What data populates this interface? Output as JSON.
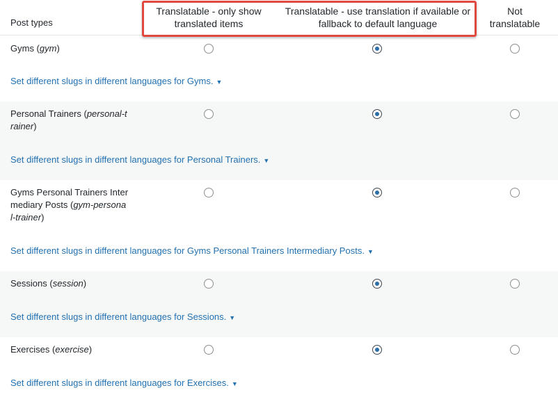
{
  "header": {
    "col_post_types": "Post types",
    "col_translatable_only": "Translatable - only show translated items",
    "col_translatable_fallback": "Translatable - use translation if available or fallback to default language",
    "col_not_translatable": "Not translatable"
  },
  "rows": [
    {
      "name_lines": [
        "Gyms (",
        "gym",
        ")"
      ],
      "selected": "fallback",
      "slug_link": "Set different slugs in different languages for Gyms."
    },
    {
      "name_line1_plain": "Personal Trainers (",
      "name_line1_italic": "personal-t",
      "name_line2_italic": "rainer",
      "name_line2_plain": ")",
      "selected": "fallback",
      "slug_link": "Set different slugs in different languages for Personal Trainers."
    },
    {
      "name_line1": "Gyms Personal Trainers Inter",
      "name_line2_plain": "mediary Posts (",
      "name_line2_italic": "gym-persona",
      "name_line3_italic": "l-trainer",
      "name_line3_plain": ")",
      "selected": "fallback",
      "slug_link": "Set different slugs in different languages for Gyms Personal Trainers Intermediary Posts."
    },
    {
      "name_plain": "Sessions (",
      "name_italic": "session",
      "name_close": ")",
      "selected": "fallback",
      "slug_link": "Set different slugs in different languages for Sessions."
    },
    {
      "name_plain": "Exercises (",
      "name_italic": "exercise",
      "name_close": ")",
      "selected": "fallback",
      "slug_link": "Set different slugs in different languages for Exercises."
    }
  ],
  "caret_glyph": "▼",
  "colors": {
    "link": "#2271b1",
    "highlight": "#e0493f",
    "alt_row": "#f6f7f7"
  }
}
